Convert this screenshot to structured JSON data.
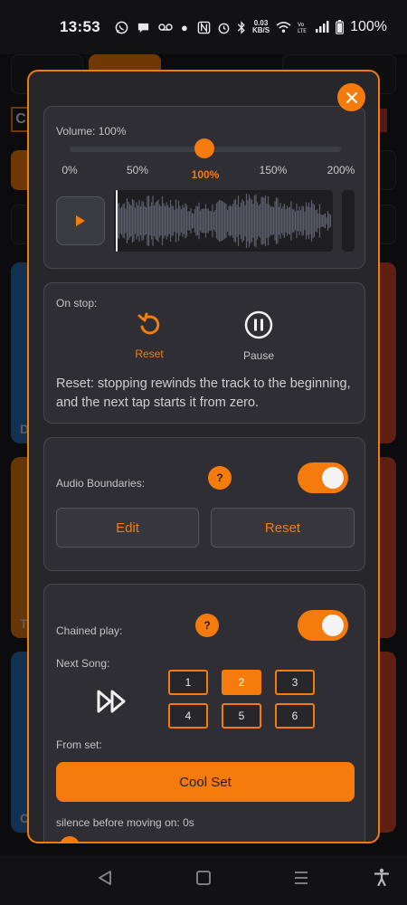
{
  "status_bar": {
    "time": "13:53",
    "net_speed_value": "0.03",
    "net_speed_unit": "KB/S",
    "battery": "100%"
  },
  "background": {
    "header_letter": "C",
    "tile_letters": [
      "D",
      "T",
      "C"
    ]
  },
  "modal": {
    "close_icon": "close-icon",
    "volume": {
      "label": "Volume: 100%",
      "value_percent": 100,
      "ticks": [
        "0%",
        "50%",
        "100%",
        "150%",
        "200%"
      ],
      "active_tick": "100%"
    },
    "on_stop": {
      "label": "On stop:",
      "options": [
        {
          "label": "Reset",
          "icon": "reset-icon",
          "selected": true
        },
        {
          "label": "Pause",
          "icon": "pause-icon",
          "selected": false
        }
      ],
      "description": "Reset: stopping rewinds the track to the beginning, and the next tap starts it from zero."
    },
    "audio_boundaries": {
      "label": "Audio Boundaries:",
      "help": "?",
      "enabled": true,
      "edit_label": "Edit",
      "reset_label": "Reset"
    },
    "chained_play": {
      "label": "Chained play:",
      "help": "?",
      "enabled": true,
      "next_song_label": "Next Song:",
      "songs": [
        "1",
        "2",
        "3",
        "4",
        "5",
        "6"
      ],
      "selected_song": "2",
      "from_set_label": "From set:",
      "set_name": "Cool Set",
      "silence_label": "silence before moving on: 0s"
    }
  },
  "colors": {
    "accent": "#f57c0c",
    "modal_bg": "#26262b",
    "card_bg": "#2e2e34"
  }
}
